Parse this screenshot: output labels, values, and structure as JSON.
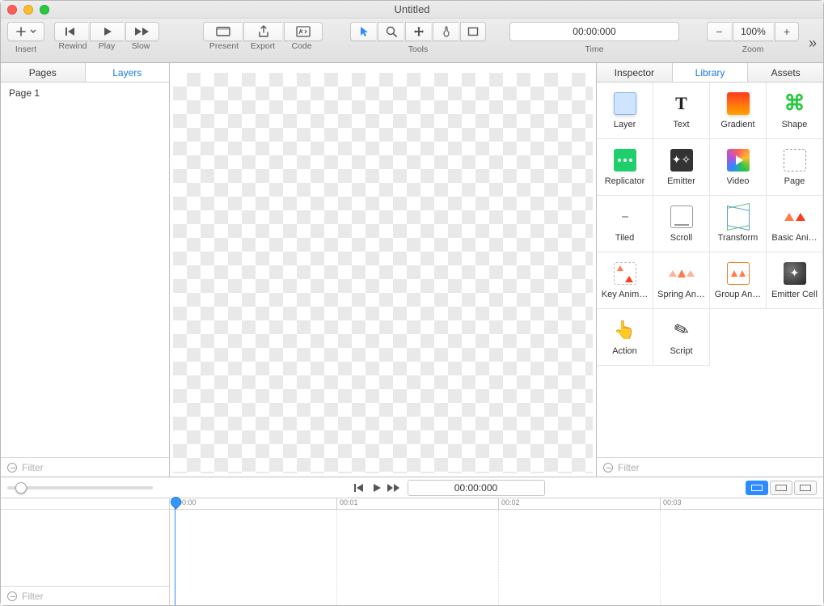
{
  "window": {
    "title": "Untitled"
  },
  "toolbar": {
    "insert": "Insert",
    "rewind": "Rewind",
    "play": "Play",
    "slow": "Slow",
    "present": "Present",
    "export": "Export",
    "code": "Code",
    "tools": "Tools",
    "time": "Time",
    "time_value": "00:00:000",
    "zoom": "Zoom",
    "zoom_value": "100%"
  },
  "left_panel": {
    "tabs": {
      "pages": "Pages",
      "layers": "Layers"
    },
    "page1": "Page 1",
    "filter": "Filter"
  },
  "right_panel": {
    "tabs": {
      "inspector": "Inspector",
      "library": "Library",
      "assets": "Assets"
    },
    "items": {
      "layer": "Layer",
      "text": "Text",
      "gradient": "Gradient",
      "shape": "Shape",
      "replicator": "Replicator",
      "emitter": "Emitter",
      "video": "Video",
      "page": "Page",
      "tiled": "Tiled",
      "scroll": "Scroll",
      "transform": "Transform",
      "basic": "Basic Ani…",
      "keyanim": "Key Anim…",
      "spring": "Spring An…",
      "group": "Group An…",
      "cell": "Emitter Cell",
      "action": "Action",
      "script": "Script"
    },
    "filter": "Filter"
  },
  "timeline": {
    "time_value": "00:00:000",
    "ticks": [
      "00:00",
      "00:01",
      "00:02",
      "00:03"
    ],
    "filter": "Filter"
  }
}
